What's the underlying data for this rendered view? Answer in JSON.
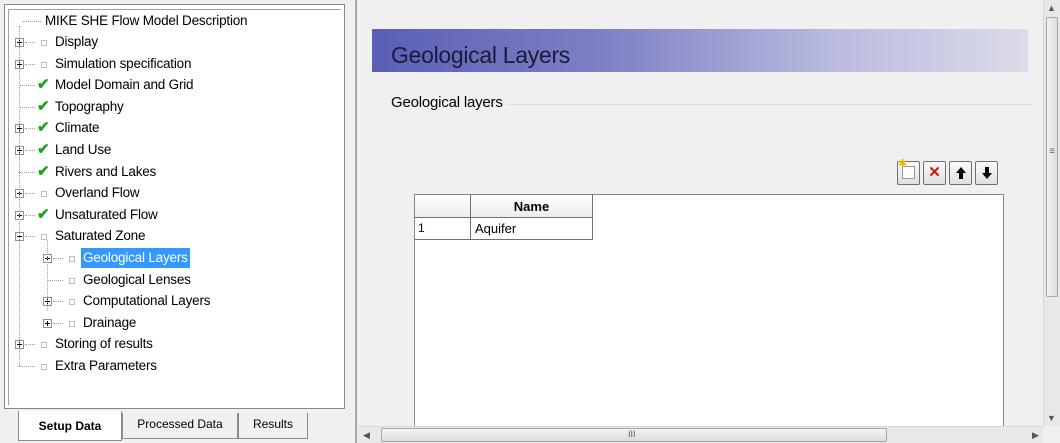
{
  "tree": {
    "root_label": "MIKE SHE Flow Model Description",
    "items": [
      {
        "label": "Display",
        "state": "box",
        "expander": "plus",
        "level": 1
      },
      {
        "label": "Simulation specification",
        "state": "box",
        "expander": "plus",
        "level": 1
      },
      {
        "label": "Model Domain and Grid",
        "state": "check",
        "expander": "none",
        "level": 1
      },
      {
        "label": "Topography",
        "state": "check",
        "expander": "none",
        "level": 1
      },
      {
        "label": "Climate",
        "state": "check",
        "expander": "plus",
        "level": 1
      },
      {
        "label": "Land Use",
        "state": "check",
        "expander": "plus",
        "level": 1
      },
      {
        "label": "Rivers and Lakes",
        "state": "check",
        "expander": "none",
        "level": 1
      },
      {
        "label": "Overland Flow",
        "state": "box",
        "expander": "plus",
        "level": 1
      },
      {
        "label": "Unsaturated Flow",
        "state": "check",
        "expander": "plus",
        "level": 1
      },
      {
        "label": "Saturated Zone",
        "state": "box",
        "expander": "minus",
        "level": 1
      },
      {
        "label": "Geological Layers",
        "state": "box",
        "expander": "plus",
        "level": 2,
        "selected": true
      },
      {
        "label": "Geological Lenses",
        "state": "box",
        "expander": "none",
        "level": 2
      },
      {
        "label": "Computational Layers",
        "state": "box",
        "expander": "plus",
        "level": 2
      },
      {
        "label": "Drainage",
        "state": "box",
        "expander": "plus",
        "level": 2
      },
      {
        "label": "Storing of results",
        "state": "box",
        "expander": "plus",
        "level": 1
      },
      {
        "label": "Extra Parameters",
        "state": "box",
        "expander": "none",
        "level": 1
      }
    ]
  },
  "tabs": [
    {
      "label": "Setup Data",
      "active": true
    },
    {
      "label": "Processed Data",
      "active": false
    },
    {
      "label": "Results",
      "active": false
    }
  ],
  "header": {
    "title": "Geological Layers"
  },
  "group": {
    "title": "Geological layers"
  },
  "toolbar": {
    "buttons": [
      {
        "name": "new-icon",
        "glyph": "✱"
      },
      {
        "name": "delete-icon",
        "glyph": "✕"
      },
      {
        "name": "arrow-up-icon",
        "glyph": "🡑"
      },
      {
        "name": "arrow-down-icon",
        "glyph": "🡓"
      }
    ]
  },
  "grid": {
    "column_header": "Name",
    "rows": [
      {
        "num": "1",
        "name": "Aquifer"
      }
    ]
  },
  "scrollbar": {
    "grip": "III"
  },
  "colors": {
    "check": "#1aa31a",
    "selected": "#3399ff",
    "banner_start": "#5b5fb4"
  }
}
